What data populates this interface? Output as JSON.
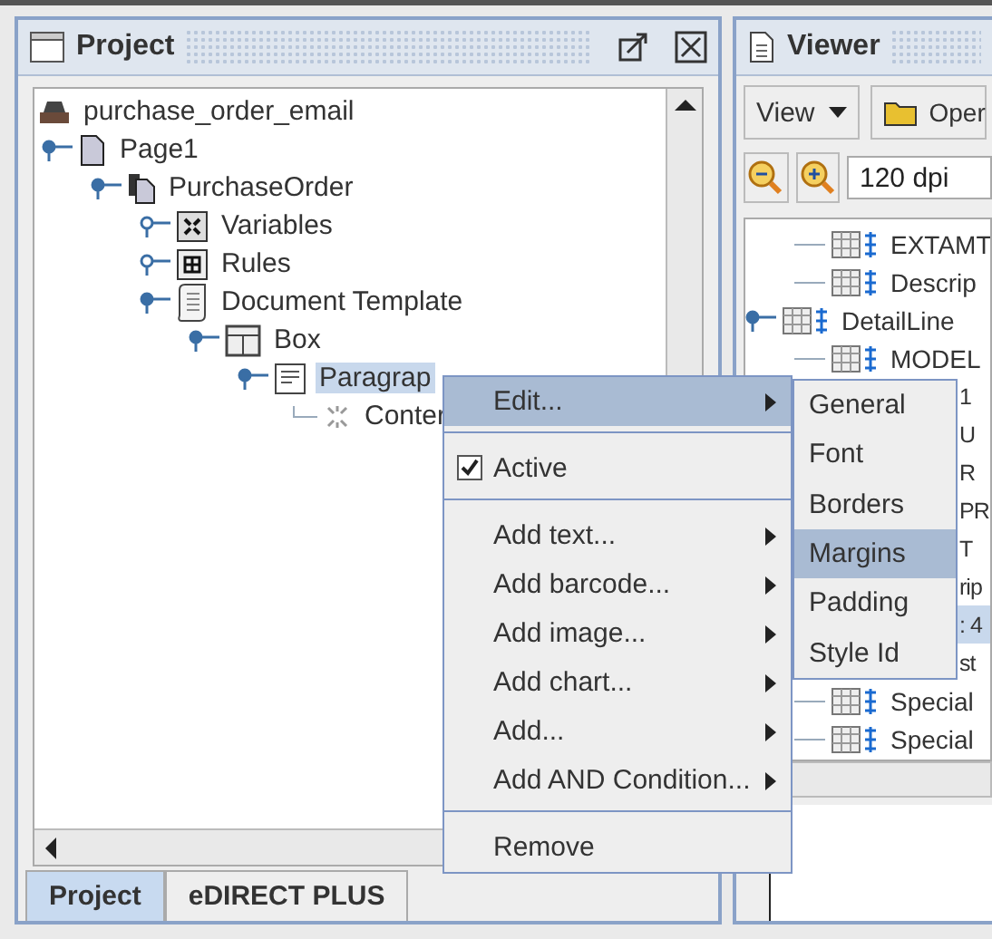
{
  "project_panel": {
    "title": "Project",
    "tree": [
      {
        "label": "purchase_order_email",
        "kind": "project",
        "selected": false,
        "children": [
          {
            "label": "Page1",
            "kind": "page",
            "selected": false,
            "expanded": true,
            "children": [
              {
                "label": "PurchaseOrder",
                "kind": "pages",
                "selected": false,
                "expanded": true,
                "children": [
                  {
                    "label": "Variables",
                    "kind": "variables",
                    "selected": false,
                    "expanded": false
                  },
                  {
                    "label": "Rules",
                    "kind": "rules",
                    "selected": false,
                    "expanded": false
                  },
                  {
                    "label": "Document Template",
                    "kind": "template",
                    "selected": false,
                    "expanded": true,
                    "children": [
                      {
                        "label": "Box",
                        "kind": "box",
                        "selected": false,
                        "expanded": true,
                        "children": [
                          {
                            "label": "Paragrap",
                            "kind": "paragraph",
                            "selected": true,
                            "expanded": true,
                            "children": [
                              {
                                "label": "Conter",
                                "kind": "content",
                                "selected": false
                              }
                            ]
                          }
                        ]
                      }
                    ]
                  }
                ]
              }
            ]
          }
        ]
      }
    ],
    "tabs": [
      {
        "label": "Project",
        "selected": true
      },
      {
        "label": "eDIRECT PLUS",
        "selected": false
      }
    ]
  },
  "viewer_panel": {
    "title": "Viewer",
    "view_menu": "View",
    "open_button": "Oper",
    "zoom_field": "120 dpi",
    "rows_above": [
      {
        "label": "EXTAMT",
        "kind": "row",
        "selected": false
      },
      {
        "label": "Descrip",
        "kind": "row",
        "selected": false
      }
    ],
    "tree": [
      {
        "label": "DetailLine",
        "kind": "row",
        "selected": false,
        "expanded": true,
        "children": [
          {
            "label": "MODEL",
            "kind": "row",
            "selected": false
          },
          {
            "label": "1",
            "kind": "covered",
            "selected": false
          },
          {
            "label": "U",
            "kind": "covered",
            "selected": false
          },
          {
            "label": "R",
            "kind": "covered",
            "selected": false
          },
          {
            "label": "PR",
            "kind": "covered",
            "selected": false
          },
          {
            "label": "T",
            "kind": "covered",
            "selected": false
          },
          {
            "label": "rip",
            "kind": "covered",
            "selected": false
          },
          {
            "label": ": 4",
            "kind": "covered",
            "selected": true
          },
          {
            "label": "st",
            "kind": "covered",
            "selected": false
          },
          {
            "label": "Special",
            "kind": "row",
            "selected": false
          },
          {
            "label": "Special",
            "kind": "row",
            "selected": false
          }
        ]
      }
    ]
  },
  "context_menu": {
    "groups": [
      [
        {
          "label": "Edit...",
          "kind": "submenu",
          "selected": true
        }
      ],
      [
        {
          "label": "Active",
          "kind": "check",
          "checked": true,
          "selected": false
        }
      ],
      [
        {
          "label": "Add text...",
          "kind": "submenu",
          "selected": false
        },
        {
          "label": "Add barcode...",
          "kind": "submenu",
          "selected": false
        },
        {
          "label": "Add image...",
          "kind": "submenu",
          "selected": false
        },
        {
          "label": "Add chart...",
          "kind": "submenu",
          "selected": false
        },
        {
          "label": "Add...",
          "kind": "submenu",
          "selected": false
        },
        {
          "label": "Add AND Condition...",
          "kind": "submenu",
          "selected": false
        }
      ],
      [
        {
          "label": "Remove",
          "kind": "item",
          "selected": false
        }
      ]
    ],
    "submenu": [
      {
        "label": "General",
        "selected": false
      },
      {
        "label": "Font",
        "selected": false
      },
      {
        "label": "Borders",
        "selected": false
      },
      {
        "label": "Margins",
        "selected": true
      },
      {
        "label": "Padding",
        "selected": false
      },
      {
        "label": "Style Id",
        "selected": false
      }
    ]
  }
}
